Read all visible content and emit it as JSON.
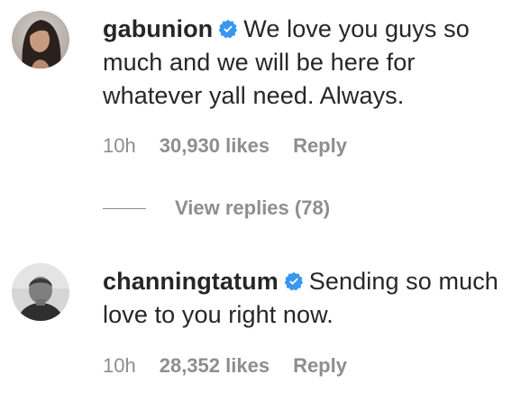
{
  "comments": [
    {
      "username": "gabunion",
      "verified": true,
      "text": "We love you guys so much and we will be here for whatever yall need. Always.",
      "time": "10h",
      "likes": "30,930 likes",
      "reply_label": "Reply",
      "view_replies_label": "View replies (78)"
    },
    {
      "username": "channingtatum",
      "verified": true,
      "text": "Sending so much love to you right now.",
      "time": "10h",
      "likes": "28,352 likes",
      "reply_label": "Reply"
    }
  ],
  "colors": {
    "text": "#262626",
    "muted": "#8e8e8e",
    "verified_badge": "#3897f0"
  },
  "icons": {
    "verified": "verified-badge-icon"
  }
}
